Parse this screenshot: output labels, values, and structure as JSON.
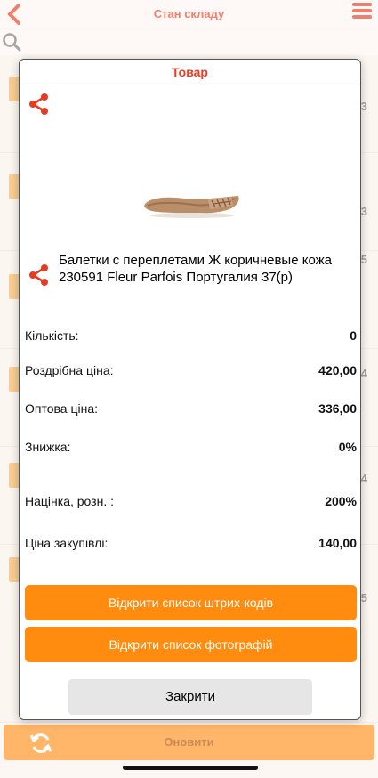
{
  "appbar": {
    "title": "Стан складу"
  },
  "bottombar": {
    "refresh_label": "Оновити"
  },
  "background_rows": [
    {
      "qty": "3"
    },
    {
      "qty": "3"
    },
    {
      "qty": "5"
    },
    {
      "qty": "4"
    },
    {
      "qty": "4"
    },
    {
      "qty": "5"
    }
  ],
  "dialog": {
    "title": "Товар",
    "product_name": "Балетки с переплетами Ж коричневые кожа 230591 Fleur Parfois Португалия 37(р)",
    "fields": [
      {
        "label": "Кількість:",
        "value": "0"
      },
      {
        "label": "Роздрібна ціна:",
        "value": "420,00"
      },
      {
        "label": "Оптова ціна:",
        "value": "336,00"
      },
      {
        "label": "Знижка:",
        "value": "0%"
      },
      {
        "label": "Націнка, розн. :",
        "value": "200%"
      },
      {
        "label": "Ціна закупівлі:",
        "value": "140,00"
      }
    ],
    "barcodes_button": "Відкрити список штрих-кодів",
    "photos_button": "Відкрити список фотографій",
    "close_button": "Закрити"
  },
  "colors": {
    "accent_red": "#e53c24",
    "button_orange": "#ff8c0f",
    "close_gray": "#e6e6e6"
  },
  "icons": {
    "back": "chevron-left-icon",
    "menu": "hamburger-icon",
    "search": "search-icon",
    "share": "share-icon",
    "refresh": "refresh-icon"
  }
}
